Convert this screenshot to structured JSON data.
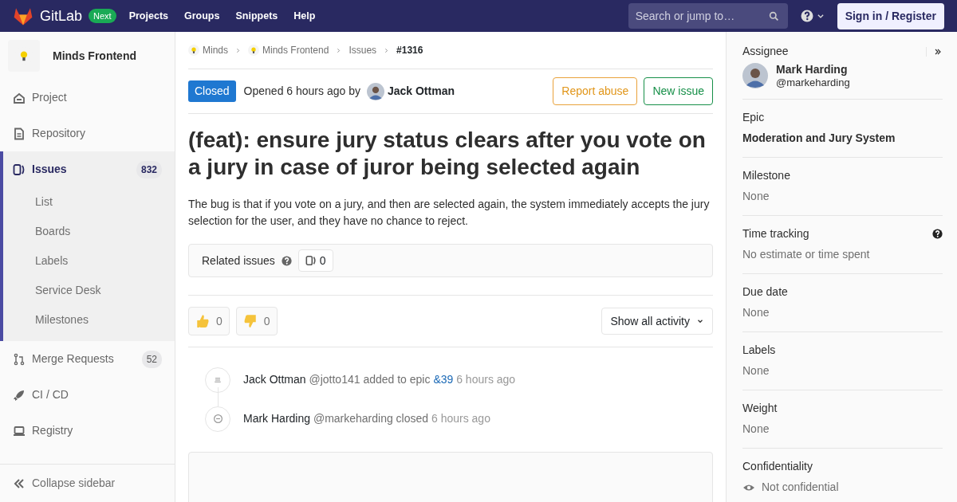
{
  "topbar": {
    "brand": "GitLab",
    "badge": "Next",
    "links": [
      "Projects",
      "Groups",
      "Snippets",
      "Help"
    ],
    "search": {
      "placeholder": "Search or jump to…"
    },
    "sign_in": "Sign in / Register"
  },
  "sidebar": {
    "project": "Minds Frontend",
    "items": [
      {
        "label": "Project",
        "selected": false
      },
      {
        "label": "Repository",
        "selected": false
      },
      {
        "label": "Issues",
        "count": "832",
        "selected": true,
        "children": [
          {
            "label": "List"
          },
          {
            "label": "Boards"
          },
          {
            "label": "Labels"
          },
          {
            "label": "Service Desk"
          },
          {
            "label": "Milestones"
          }
        ]
      },
      {
        "label": "Merge Requests",
        "count": "52",
        "selected": false
      },
      {
        "label": "CI / CD",
        "selected": false
      },
      {
        "label": "Registry",
        "selected": false
      }
    ],
    "collapse": "Collapse sidebar"
  },
  "breadcrumbs": [
    "Minds",
    "Minds Frontend",
    "Issues",
    "#1316"
  ],
  "issue": {
    "status": "Closed",
    "opened": "Opened 6 hours ago by",
    "author": "Jack Ottman",
    "actions": [
      "Report abuse",
      "New issue"
    ],
    "title": "(feat): ensure jury status clears after you vote on a jury in case of juror being selected again",
    "description": "The bug is that if you vote on a jury, and then are selected again, the system immediately accepts the jury selection for the user, and they have no chance to reject.",
    "related": {
      "label": "Related issues",
      "count": "0"
    },
    "reactions": [
      {
        "kind": "up",
        "count": "0"
      },
      {
        "kind": "down",
        "count": "0"
      }
    ],
    "activity_filter": "Show all activity",
    "notes": [
      {
        "kind": "epic",
        "author": "Jack Ottman",
        "handle": "@jotto141",
        "action": "added to epic",
        "link": "&39",
        "time": "6 hours ago"
      },
      {
        "kind": "closed",
        "author": "Mark Harding",
        "handle": "@markeharding",
        "action": "closed",
        "time": "6 hours ago"
      }
    ]
  },
  "right_sidebar": {
    "assignee": {
      "label": "Assignee",
      "name": "Mark Harding",
      "handle": "@markeharding"
    },
    "blocks": [
      {
        "label": "Epic",
        "value": "Moderation and Jury System",
        "kind": "strong"
      },
      {
        "label": "Milestone",
        "value": "None",
        "kind": "muted"
      },
      {
        "label": "Time tracking",
        "value": "No estimate or time spent",
        "kind": "muted",
        "help": true
      },
      {
        "label": "Due date",
        "value": "None",
        "kind": "muted"
      },
      {
        "label": "Labels",
        "value": "None",
        "kind": "muted"
      },
      {
        "label": "Weight",
        "value": "None",
        "kind": "muted"
      },
      {
        "label": "Confidentiality",
        "value": "Not confidential",
        "kind": "eye"
      }
    ]
  }
}
